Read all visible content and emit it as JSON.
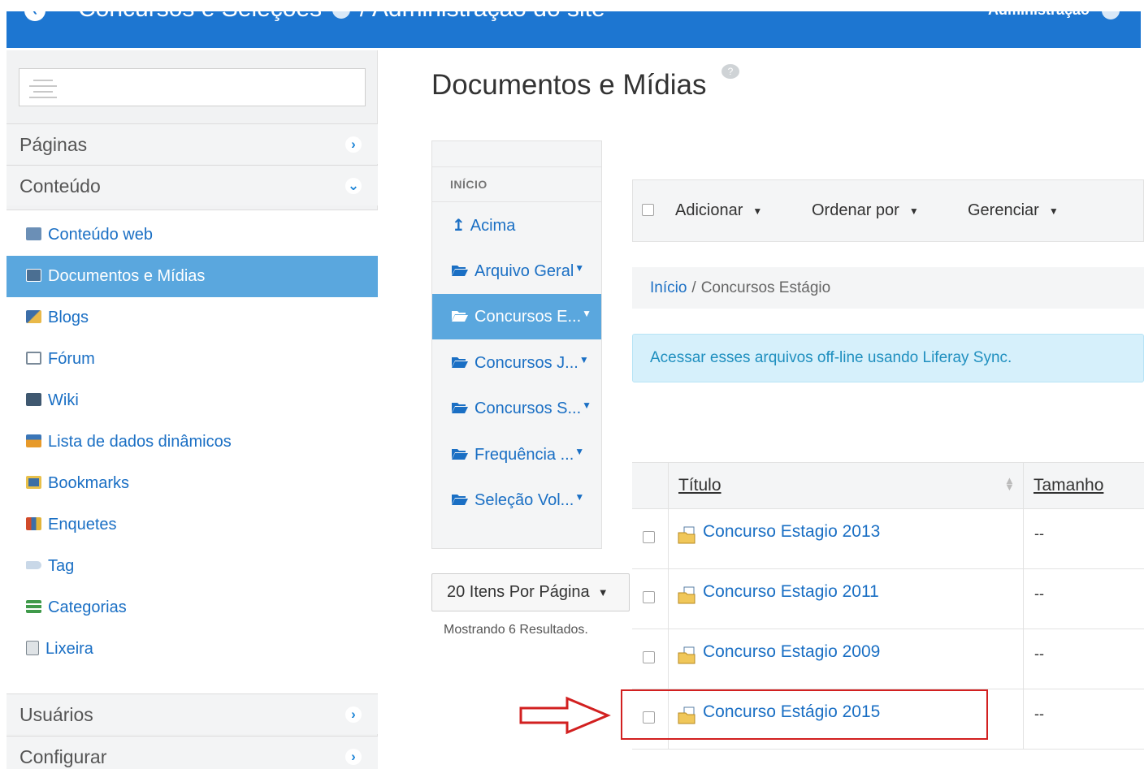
{
  "header": {
    "site_title": "Concursos e Seleções",
    "site_title_suffix": "/ Administração do site",
    "admin_label": "Administração"
  },
  "sidebar": {
    "sections": [
      {
        "label": "Páginas",
        "state": "collapsed"
      },
      {
        "label": "Conteúdo",
        "state": "expanded"
      },
      {
        "label": "Usuários",
        "state": "collapsed"
      },
      {
        "label": "Configurar",
        "state": "collapsed"
      }
    ],
    "items": [
      {
        "label": "Conteúdo web",
        "icon": "web-content-icon"
      },
      {
        "label": "Documentos e Mídias",
        "icon": "documents-icon",
        "active": true
      },
      {
        "label": "Blogs",
        "icon": "blogs-icon"
      },
      {
        "label": "Fórum",
        "icon": "forum-icon"
      },
      {
        "label": "Wiki",
        "icon": "wiki-icon"
      },
      {
        "label": "Lista de dados dinâmicos",
        "icon": "dynamic-data-icon"
      },
      {
        "label": "Bookmarks",
        "icon": "bookmarks-icon"
      },
      {
        "label": "Enquetes",
        "icon": "polls-icon"
      },
      {
        "label": "Tag",
        "icon": "tag-icon"
      },
      {
        "label": "Categorias",
        "icon": "categories-icon"
      },
      {
        "label": "Lixeira",
        "icon": "trash-icon"
      }
    ]
  },
  "main": {
    "title": "Documentos e Mídias",
    "help_glyph": "?",
    "folders": {
      "heading": "INÍCIO",
      "up_label": "Acima",
      "items": [
        {
          "label": "Arquivo Geral"
        },
        {
          "label": "Concursos E...",
          "active": true
        },
        {
          "label": "Concursos J..."
        },
        {
          "label": "Concursos S..."
        },
        {
          "label": "Frequência ..."
        },
        {
          "label": "Seleção Vol..."
        }
      ]
    },
    "pagination": {
      "per_page": "20 Itens Por Página",
      "results": "Mostrando 6 Resultados."
    },
    "toolbar": {
      "add": "Adicionar",
      "sort": "Ordenar por",
      "manage": "Gerenciar"
    },
    "breadcrumb": {
      "root": "Início",
      "separator": "/",
      "current": "Concursos Estágio"
    },
    "alert": "Acessar esses arquivos off-line usando Liferay Sync.",
    "table": {
      "columns": [
        "Título",
        "Tamanho"
      ],
      "rows": [
        {
          "title": "Concurso Estagio 2013",
          "size": "--"
        },
        {
          "title": "Concurso Estagio 2011",
          "size": "--"
        },
        {
          "title": "Concurso Estagio 2009",
          "size": "--"
        },
        {
          "title": "Concurso Estágio 2015",
          "size": "--",
          "highlighted": true
        }
      ]
    }
  },
  "colors": {
    "header_blue": "#1d76d1",
    "active_blue": "#5aa7de",
    "link_blue": "#1a6fc4",
    "alert_bg": "#d6f0fb",
    "highlight_red": "#d22020"
  }
}
